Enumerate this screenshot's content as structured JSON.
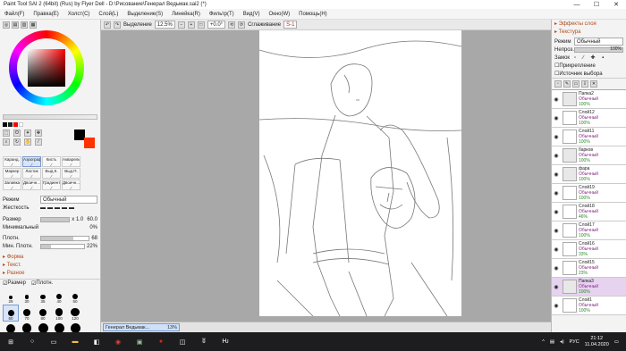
{
  "window": {
    "title": "Paint Tool SAI 2 (64bit) (Rus) by Flyer Dell - D:\\Рисование\\Генерал Ведьмак.sai2 (*)",
    "minimize": "—",
    "maximize": "☐",
    "close": "✕"
  },
  "menu": [
    "Файл(F)",
    "Правка(E)",
    "Холст(C)",
    "Слой(L)",
    "Выделение(S)",
    "Линейка(R)",
    "Фильтр(T)",
    "Вид(V)",
    "Окно(W)",
    "Помощь(H)"
  ],
  "toolbar": {
    "selection_label": "Выделение",
    "zoom": "12.5%",
    "rotation": "+0.0°",
    "smoothing_label": "Сглаживание",
    "smoothing_value": "S-1"
  },
  "left": {
    "tools": [
      "Каранд.",
      "Аэрограф",
      "Кисть",
      "Акварель",
      "Маркер",
      "Ластик",
      "Выд.К.",
      "Выд.П.",
      "Заливка",
      "Двоичн...",
      "Градиент",
      "Двоичн..."
    ],
    "selected_tool": "Аэрограф",
    "mode_label": "Режим",
    "mode_value": "Обычный",
    "hardness_label": "Жесткость",
    "size_label": "Размер",
    "size_mult": "x 1.0",
    "size_value": "60.0",
    "min_label": "Минимальный",
    "min_value": "0%",
    "density_label": "Плотн.",
    "density_value": "68",
    "density_fraction": 0.68,
    "min_density_label": "Мин. Плотн.",
    "min_density_value": "22%",
    "min_density_fraction": 0.22,
    "sections": [
      "Форма",
      "Текст.",
      "Разное"
    ],
    "check_size": "Размер",
    "check_density": "Плотн.",
    "brush_sizes": [
      "25",
      "30",
      "35",
      "40",
      "50",
      "60",
      "70",
      "80",
      "100",
      "120",
      "160",
      "200",
      "250",
      "300",
      "350"
    ],
    "selected_brush": "60"
  },
  "right": {
    "effects_label": "Эффекты слоя",
    "texture_label": "Текстура",
    "mode_label": "Режим",
    "mode_value": "Обычный",
    "opacity_label": "Непроз.",
    "opacity_value": "100%",
    "lock_label": "Замок",
    "clip_label": "Прикрепление",
    "source_label": "Источник выбора",
    "layers": [
      {
        "name": "Папка2",
        "mode": "Обычный",
        "op": "100%",
        "folder": true,
        "sel": false
      },
      {
        "name": "Слой12",
        "mode": "Обычный",
        "op": "100%",
        "folder": false,
        "sel": false
      },
      {
        "name": "Слой11",
        "mode": "Обычный",
        "op": "100%",
        "folder": false,
        "sel": false
      },
      {
        "name": "барков",
        "mode": "Обычный",
        "op": "100%",
        "folder": true,
        "sel": false
      },
      {
        "name": "фара",
        "mode": "Обычный",
        "op": "100%",
        "folder": true,
        "sel": false
      },
      {
        "name": "Слой19",
        "mode": "Обычный",
        "op": "100%",
        "folder": false,
        "sel": false
      },
      {
        "name": "Слой18",
        "mode": "Обычный",
        "op": "46%",
        "folder": false,
        "sel": false
      },
      {
        "name": "Слой17",
        "mode": "Обычный",
        "op": "100%",
        "folder": false,
        "sel": false
      },
      {
        "name": "Слой16",
        "mode": "Обычный",
        "op": "33%",
        "folder": false,
        "sel": false
      },
      {
        "name": "Слой15",
        "mode": "Обычный",
        "op": "23%",
        "folder": false,
        "sel": false
      },
      {
        "name": "Папка3",
        "mode": "Обычный",
        "op": "100%",
        "folder": true,
        "sel": true
      },
      {
        "name": "Слой1",
        "mode": "Обычный",
        "op": "100%",
        "folder": false,
        "sel": false
      }
    ]
  },
  "status": {
    "doc_name": "Генерал Ведьмак...",
    "zoom": "13%"
  },
  "taskbar": {
    "lang": "РУС",
    "time": "21:12",
    "date": "11.04.2020"
  },
  "colors": {
    "primary": "#000000",
    "secondary": "#ff3300",
    "accent": "#7a9ad0",
    "layer_selected": "#e6d3ef"
  }
}
